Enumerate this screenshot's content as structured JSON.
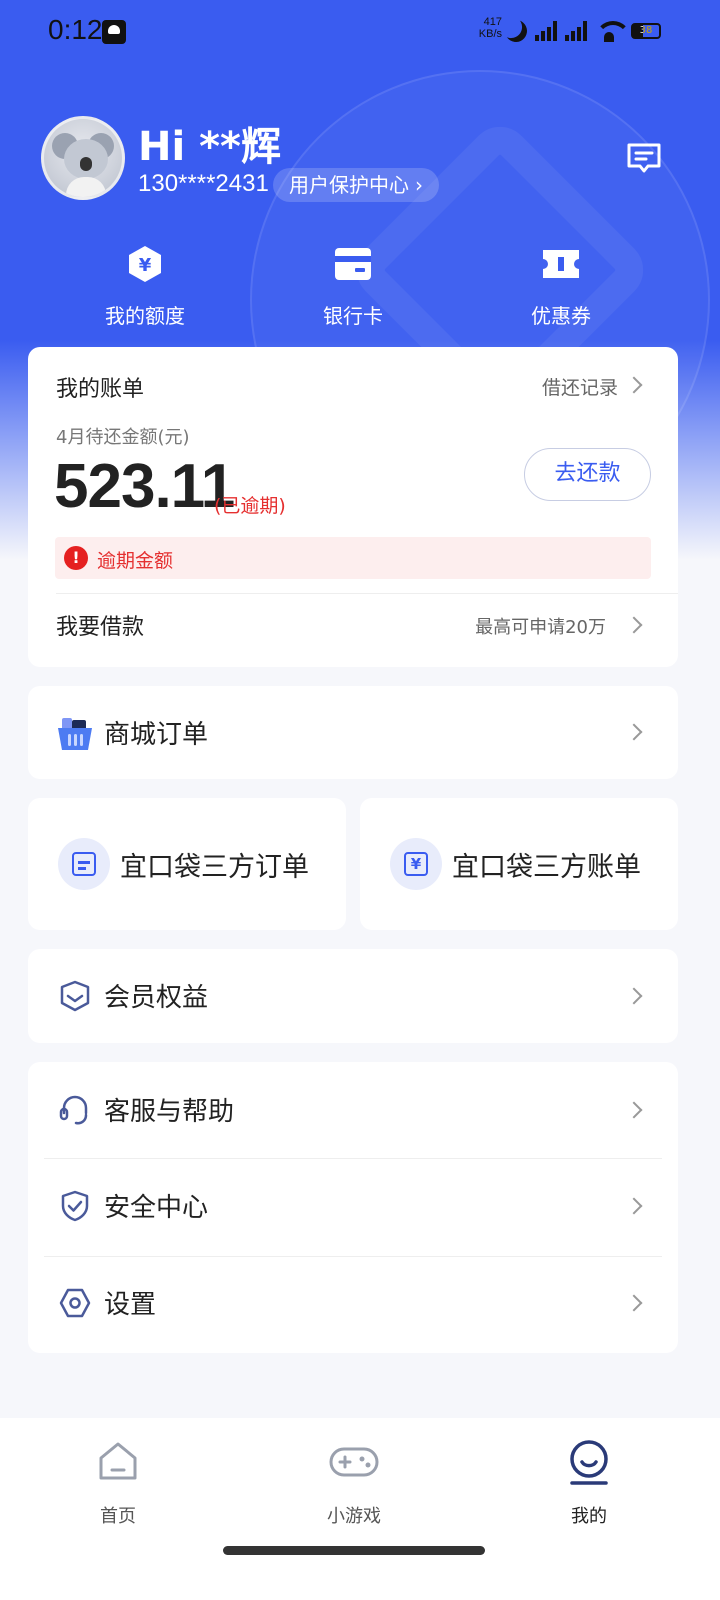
{
  "status_bar": {
    "time": "0:12",
    "net_speed_value": "417",
    "net_speed_unit": "KB/s",
    "battery": "38"
  },
  "profile": {
    "greeting": "Hi **辉",
    "phone": "130****2431",
    "protect_center": "用户保护中心",
    "protect_chevron": "›"
  },
  "quick_actions": [
    {
      "label": "我的额度",
      "icon": "yen-hexagon-icon"
    },
    {
      "label": "银行卡",
      "icon": "bank-card-icon"
    },
    {
      "label": "优惠券",
      "icon": "coupon-ticket-icon"
    }
  ],
  "bill": {
    "title": "我的账单",
    "history_link": "借还记录",
    "due_label": "4月待还金额(元)",
    "due_amount": "523.11",
    "due_status": "(已逾期)",
    "pay_button": "去还款",
    "overdue_icon": "!",
    "overdue_text": "逾期金额",
    "borrow_title": "我要借款",
    "borrow_hint": "最高可申请20万"
  },
  "menu": {
    "mall_orders": "商城订单",
    "third_party_orders": "宜口袋三方订单",
    "third_party_bills": "宜口袋三方账单",
    "member_benefits": "会员权益",
    "service_help": "客服与帮助",
    "security_center": "安全中心",
    "settings": "设置"
  },
  "tabbar": [
    {
      "label": "首页",
      "icon": "home-icon",
      "active": false
    },
    {
      "label": "小游戏",
      "icon": "gamepad-icon",
      "active": false
    },
    {
      "label": "我的",
      "icon": "profile-face-icon",
      "active": true
    }
  ],
  "colors": {
    "brand_blue": "#3a5cf0",
    "overdue_red": "#e53030",
    "page_bg": "#f6f7fb"
  }
}
